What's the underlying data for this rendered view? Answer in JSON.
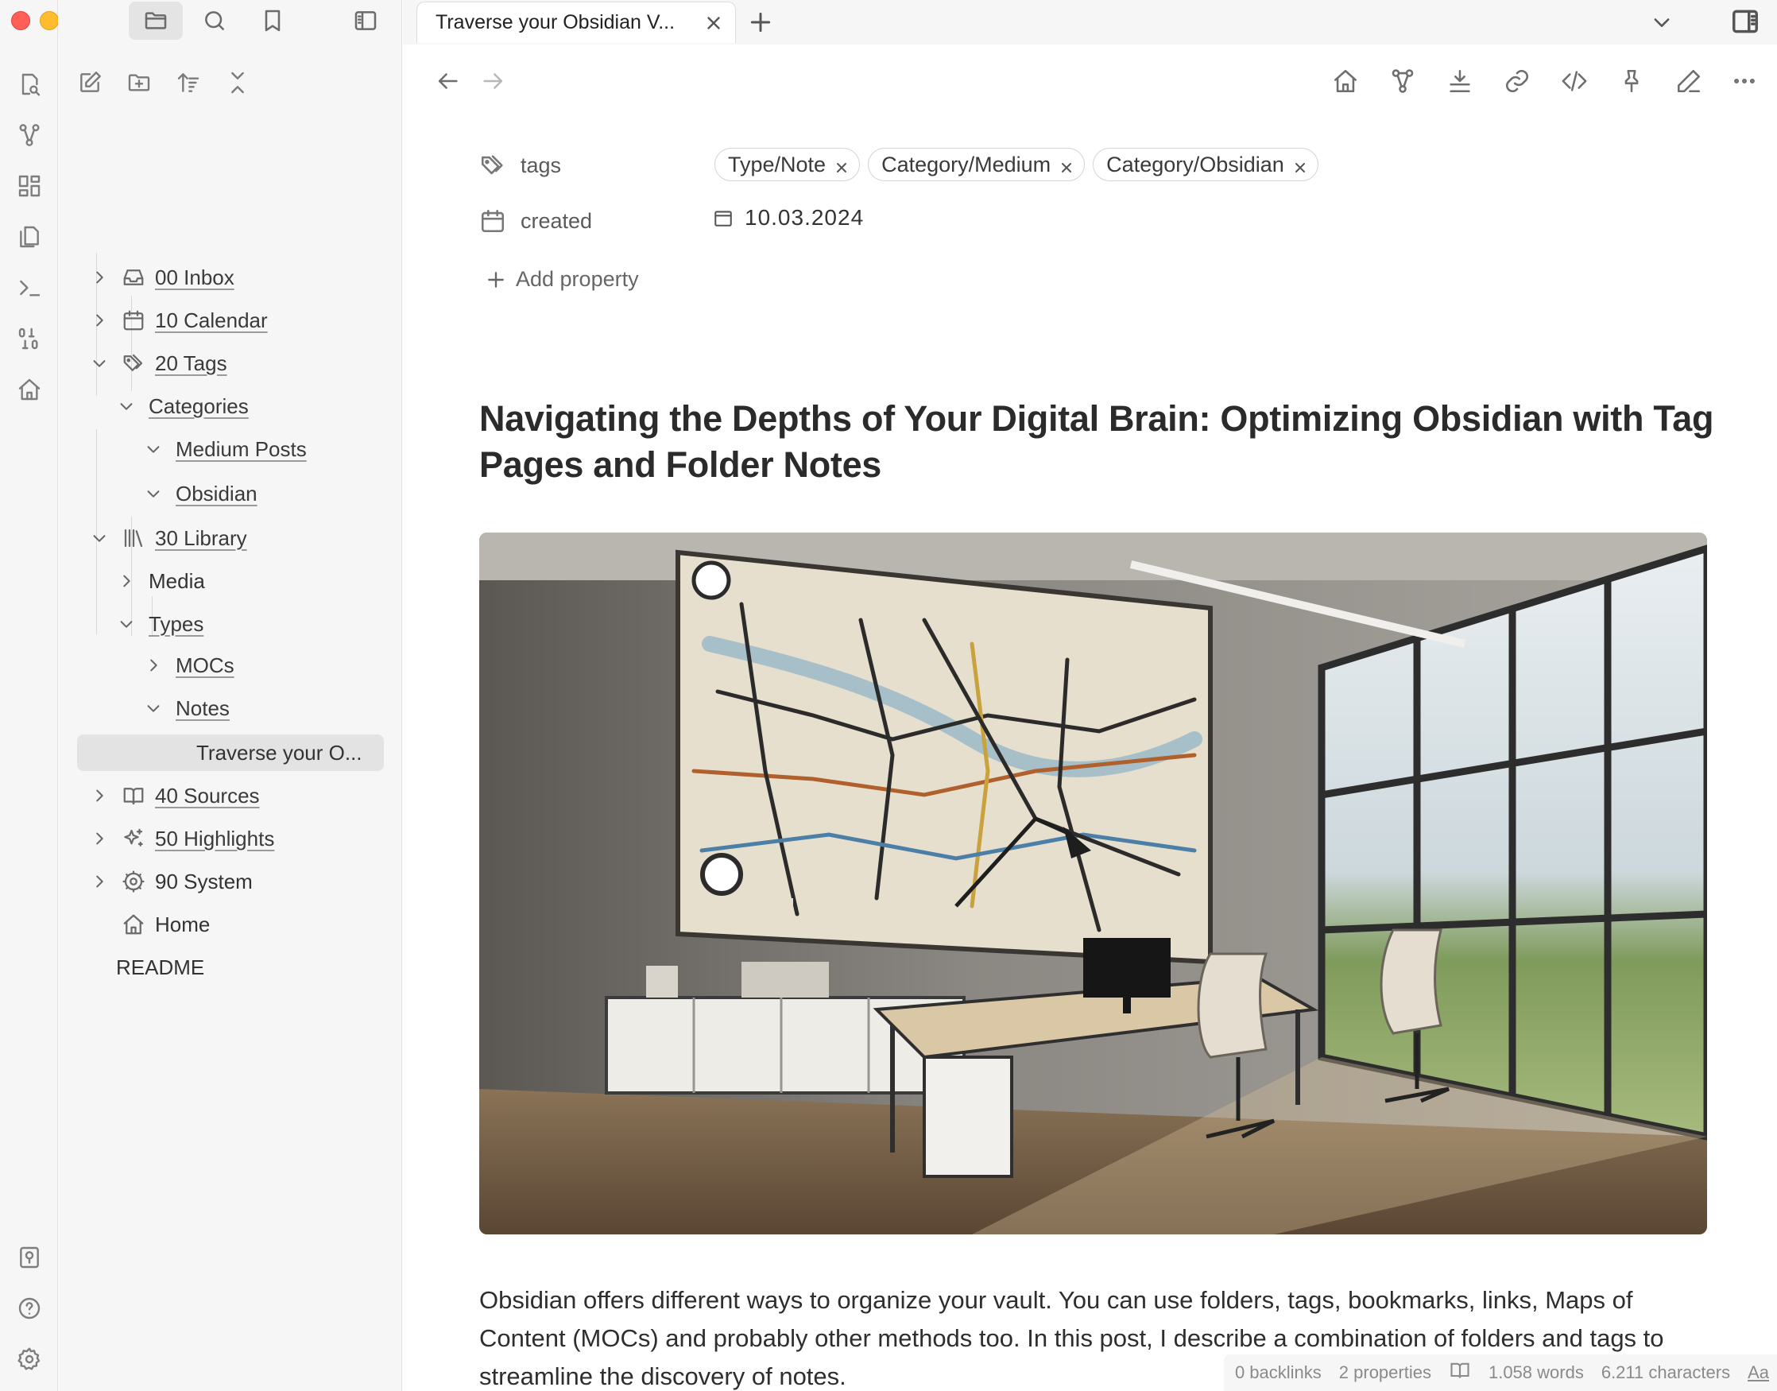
{
  "window": {
    "tab_title": "Traverse your Obsidian V..."
  },
  "sidebar": {
    "top_icons": [
      "folder-icon",
      "search-icon",
      "bookmark-icon",
      "sidebar-toggle-icon"
    ],
    "actions": [
      "new-note-icon",
      "new-folder-icon",
      "sort-icon",
      "collapse-all-icon"
    ],
    "tree": [
      {
        "label": "00 Inbox",
        "icon": "inbox-icon",
        "state": "collapsed"
      },
      {
        "label": "10 Calendar",
        "icon": "calendar-icon",
        "state": "collapsed"
      },
      {
        "label": "20 Tags",
        "icon": "tags-icon",
        "state": "expanded"
      },
      {
        "label": "Categories",
        "state": "expanded"
      },
      {
        "label": "Medium Posts",
        "state": "expanded"
      },
      {
        "label": "Obsidian",
        "state": "expanded"
      },
      {
        "label": "30 Library",
        "icon": "library-icon",
        "state": "expanded"
      },
      {
        "label": "Media",
        "state": "collapsed"
      },
      {
        "label": "Types",
        "state": "expanded"
      },
      {
        "label": "MOCs",
        "state": "collapsed"
      },
      {
        "label": "Notes",
        "state": "expanded"
      },
      {
        "label": "Traverse your O...",
        "state": "file",
        "selected": true
      },
      {
        "label": "40 Sources",
        "icon": "book-icon",
        "state": "collapsed"
      },
      {
        "label": "50 Highlights",
        "icon": "sparkles-icon",
        "state": "collapsed"
      },
      {
        "label": "90 System",
        "icon": "gear-icon",
        "state": "collapsed"
      },
      {
        "label": "Home",
        "icon": "home-icon",
        "state": "file"
      },
      {
        "label": "README",
        "state": "file"
      }
    ]
  },
  "properties": {
    "tags_label": "tags",
    "tags": [
      "Type/Note",
      "Category/Medium",
      "Category/Obsidian"
    ],
    "created_label": "created",
    "created_value": "10.03.2024",
    "add_property": "Add property"
  },
  "note": {
    "title": "Navigating the Depths of Your Digital Brain: Optimizing Obsidian with Tag Pages and Folder Notes",
    "image_alt": "Modern office with a large subway map on the wall",
    "body": "Obsidian offers different ways to organize your vault. You can use folders, tags, bookmarks, links, Maps of Content (MOCs) and probably other methods too. In this post, I describe a combination of folders and tags to streamline the discovery of notes."
  },
  "status": {
    "backlinks": "0 backlinks",
    "properties": "2 properties",
    "words": "1.058 words",
    "characters": "6.211 characters",
    "font": "Aa"
  }
}
